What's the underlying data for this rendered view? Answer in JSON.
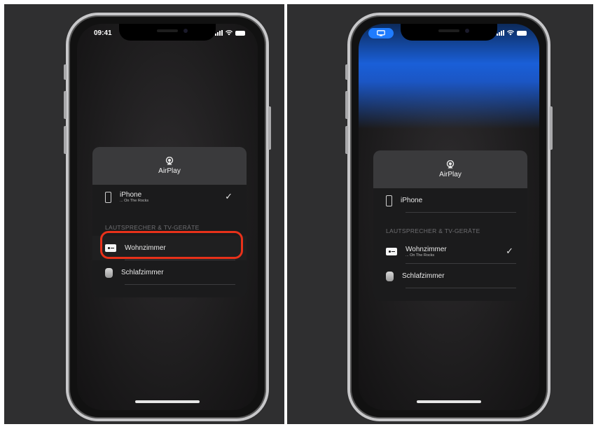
{
  "left": {
    "status": {
      "time": "09:41"
    },
    "card": {
      "title": "AirPlay",
      "iphone": {
        "name": "iPhone",
        "subtitle": "... On The Rocks",
        "checked": true
      },
      "section": "LAUTSPRECHER & TV-GERÄTE",
      "devices": [
        {
          "name": "Wohnzimmer",
          "icon": "apple-tv-icon",
          "highlighted": true
        },
        {
          "name": "Schlafzimmer",
          "icon": "homepod-icon"
        }
      ]
    }
  },
  "right": {
    "status": {
      "indicator": "screen-mirroring-icon"
    },
    "card": {
      "title": "AirPlay",
      "iphone": {
        "name": "iPhone"
      },
      "section": "LAUTSPRECHER & TV-GERÄTE",
      "devices": [
        {
          "name": "Wohnzimmer",
          "subtitle": "... On The Rocks",
          "icon": "apple-tv-icon",
          "checked": true
        },
        {
          "name": "Schlafzimmer",
          "icon": "homepod-icon"
        }
      ]
    }
  },
  "colors": {
    "highlight": "#e8311a",
    "accent": "#1f7cff",
    "panel": "#2f2f30"
  }
}
